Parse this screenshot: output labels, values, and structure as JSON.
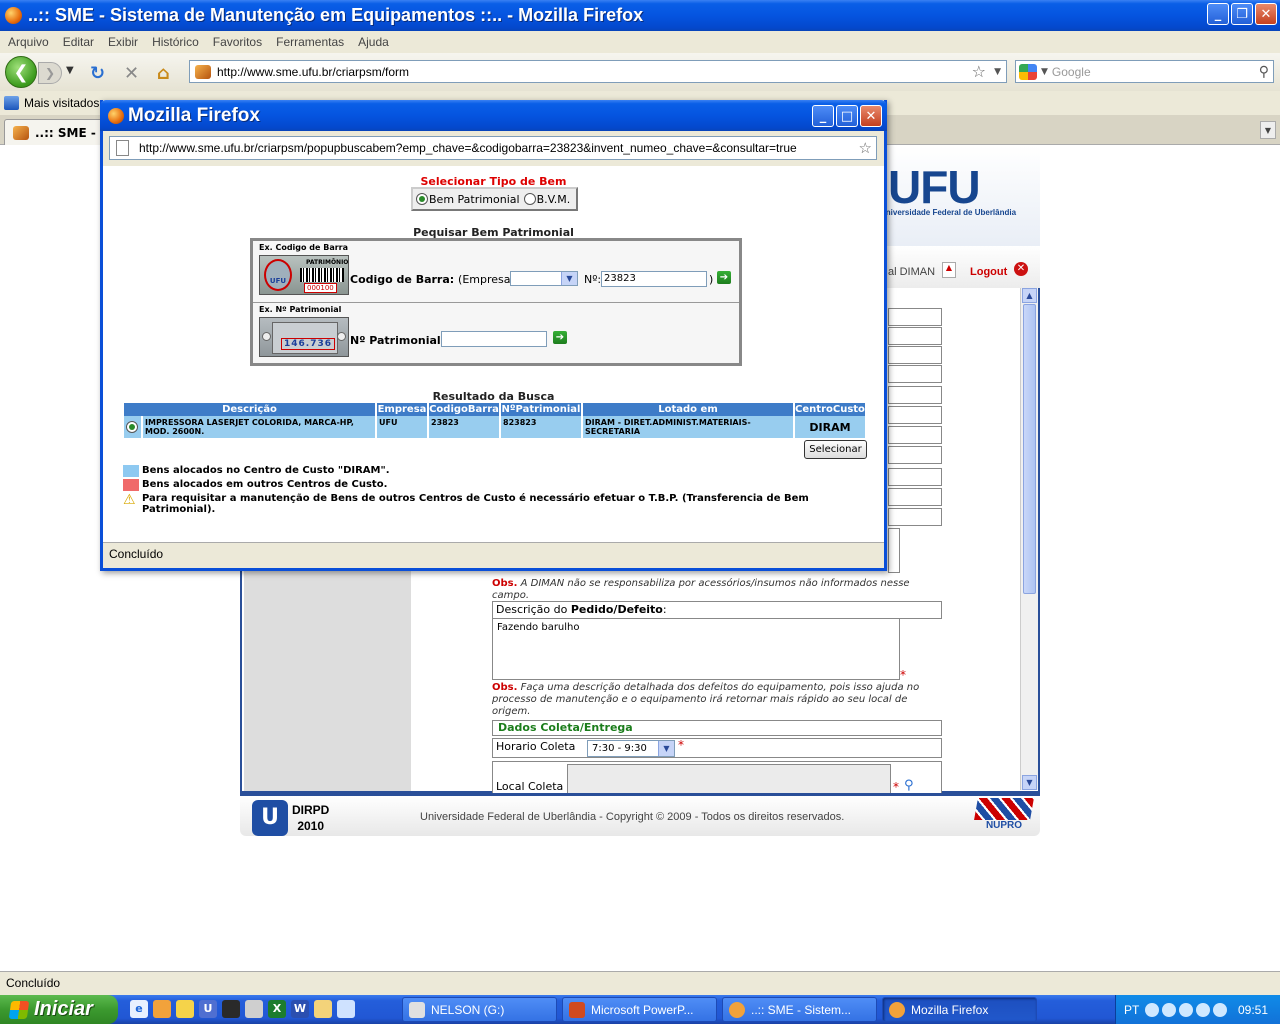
{
  "main_window": {
    "title": "..:: SME - Sistema de Manutenção em Equipamentos ::.. - Mozilla Firefox",
    "buttons": {
      "minimize": "_",
      "maximize": "❐",
      "close": "✕"
    }
  },
  "menu": [
    "Arquivo",
    "Editar",
    "Exibir",
    "Histórico",
    "Favoritos",
    "Ferramentas",
    "Ajuda"
  ],
  "navigation": {
    "url": "http://www.sme.ufu.br/criarpsm/form",
    "search_placeholder": "Google"
  },
  "bookmarks": {
    "most_visited": "Mais visitados"
  },
  "tab": {
    "label": "..:: SME - S"
  },
  "page": {
    "logo": "UFU",
    "logo_subtitle": "Universidade Federal de Uberlândia",
    "diman_link": "al DIMAN",
    "logout": "Logout",
    "obs1_label": "Obs.",
    "obs1_text": "A DIMAN não se responsabiliza por acessórios/insumos não informados nesse campo.",
    "descricao_label_pre": "Descrição do",
    "descricao_label_bold": "Pedido/Defeito",
    "descricao_label_post": ":",
    "descricao_value": "Fazendo barulho",
    "obs2_label": "Obs.",
    "obs2_text": "Faça uma descrição detalhada dos defeitos do equipamento, pois isso ajuda no processo de manutenção e o equipamento irá retornar mais rápido ao seu local de origem.",
    "dados_coleta": "Dados Coleta/Entrega",
    "horario_label": "Horario Coleta",
    "horario_value": "7:30 - 9:30",
    "local_label": "Local Coleta",
    "required_mark": "*",
    "footer_dirpd": "DIRPD",
    "footer_year": "2010",
    "footer_copyright": "Universidade Federal de Uberlândia - Copyright © 2009 - Todos os direitos reservados.",
    "footer_nupro": "NUPRO"
  },
  "main_status": "Concluído",
  "popup": {
    "title": "Mozilla Firefox",
    "url": "http://www.sme.ufu.br/criarpsm/popupbuscabem?emp_chave=&codigobarra=23823&invent_numeo_chave=&consultar=true",
    "select_type_title": "Selecionar Tipo de Bem",
    "radio_bem": "Bem Patrimonial",
    "radio_bvm": "B.V.M.",
    "search_title": "Pequisar Bem Patrimonial",
    "ex_barcode": "Ex. Codigo de Barra",
    "barcode_img_label": "PATRIMÔNIO",
    "barcode_img_num": "000100",
    "barcode_img_ufu": "UFU",
    "barcode_label": "Codigo de Barra:",
    "empresa_label": "(Empresa:",
    "num_label": "Nº:",
    "barcode_value": "23823",
    "close_paren": ")",
    "ex_patrimonial": "Ex. Nº Patrimonial",
    "plaque_num": "146.736",
    "patrimonial_label": "Nº Patrimonial:",
    "patrimonial_value": "",
    "result_title": "Resultado da Busca",
    "table": {
      "headers": [
        "Descrição",
        "Empresa",
        "CodigoBarra",
        "NºPatrimonial",
        "Lotado em",
        "CentroCusto"
      ],
      "rows": [
        {
          "descricao": "IMPRESSORA LASERJET COLORIDA, MARCA-HP, MOD. 2600N.",
          "empresa": "UFU",
          "codigo": "23823",
          "patrimonial": "823823",
          "lotado": "DIRAM - DIRET.ADMINIST.MATERIAIS-SECRETARIA",
          "centro": "DIRAM"
        }
      ]
    },
    "select_button": "Selecionar",
    "legend_blue": "Bens alocados no Centro de Custo \"DIRAM\".",
    "legend_red": "Bens alocados em outros Centros de Custo.",
    "legend_warn": "Para requisitar a manutenção de Bens de outros Centros de Custo é necessário efetuar o T.B.P. (Transferencia de Bem Patrimonial).",
    "status": "Concluído",
    "colors": {
      "blue": "#8ec9f1",
      "red": "#f06a6a",
      "header": "#3e7cc8"
    }
  },
  "taskbar": {
    "start": "Iniciar",
    "tasks": [
      "NELSON (G:)",
      "Microsoft PowerP...",
      "..:: SME - Sistem...",
      "Mozilla Firefox"
    ],
    "lang": "PT",
    "clock": "09:51"
  }
}
